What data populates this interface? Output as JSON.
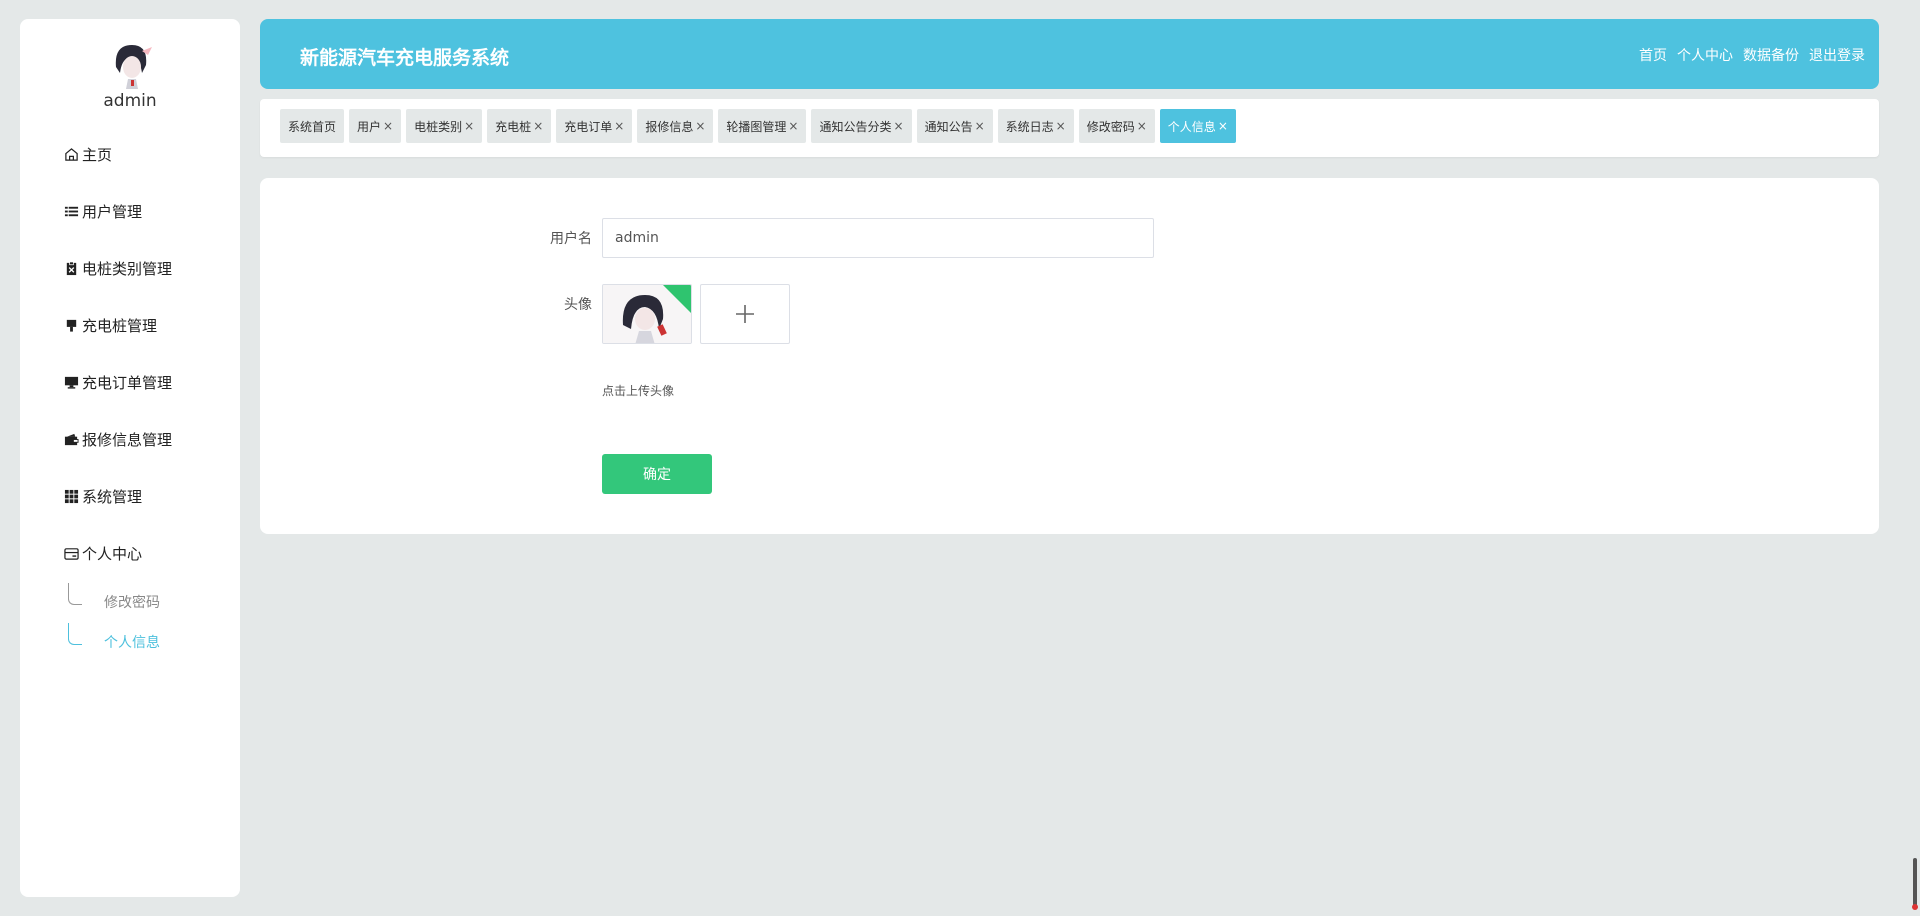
{
  "sidebar": {
    "username": "admin",
    "items": [
      {
        "label": "主页",
        "icon": "home-icon"
      },
      {
        "label": "用户管理",
        "icon": "list-icon"
      },
      {
        "label": "电桩类别管理",
        "icon": "clipboard-icon"
      },
      {
        "label": "充电桩管理",
        "icon": "brush-icon"
      },
      {
        "label": "充电订单管理",
        "icon": "monitor-icon"
      },
      {
        "label": "报修信息管理",
        "icon": "wallet-icon"
      },
      {
        "label": "系统管理",
        "icon": "grid-icon"
      },
      {
        "label": "个人中心",
        "icon": "card-icon"
      }
    ],
    "subitems": [
      {
        "label": "修改密码",
        "active": false
      },
      {
        "label": "个人信息",
        "active": true
      }
    ]
  },
  "header": {
    "title": "新能源汽车充电服务系统",
    "nav": [
      "首页",
      "个人中心",
      "数据备份",
      "退出登录"
    ]
  },
  "tabs": [
    {
      "label": "系统首页",
      "closable": false
    },
    {
      "label": "用户",
      "closable": true
    },
    {
      "label": "电桩类别",
      "closable": true
    },
    {
      "label": "充电桩",
      "closable": true
    },
    {
      "label": "充电订单",
      "closable": true
    },
    {
      "label": "报修信息",
      "closable": true
    },
    {
      "label": "轮播图管理",
      "closable": true
    },
    {
      "label": "通知公告分类",
      "closable": true
    },
    {
      "label": "通知公告",
      "closable": true
    },
    {
      "label": "系统日志",
      "closable": true
    },
    {
      "label": "修改密码",
      "closable": true
    },
    {
      "label": "个人信息",
      "closable": true,
      "active": true
    }
  ],
  "form": {
    "username_label": "用户名",
    "username_value": "admin",
    "avatar_label": "头像",
    "upload_hint": "点击上传头像",
    "submit_label": "确定"
  },
  "colors": {
    "accent": "#4ec2df",
    "submit": "#33c77b",
    "background": "#e4e8e8"
  },
  "close_glyph": "×"
}
